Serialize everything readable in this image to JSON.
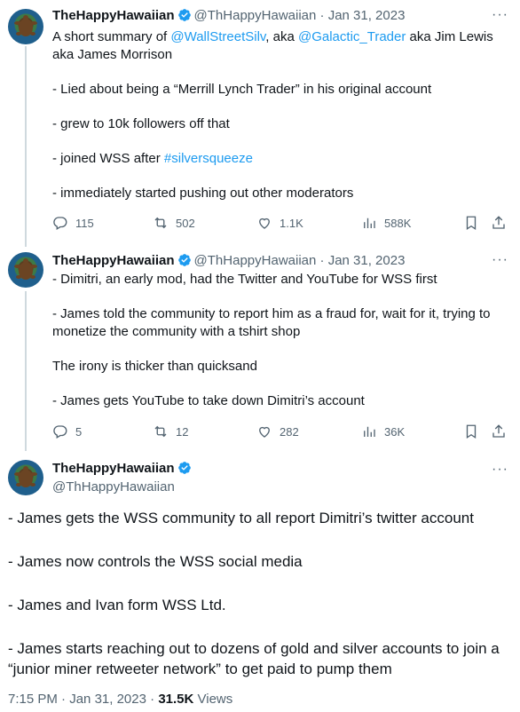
{
  "tweets": [
    {
      "name": "TheHappyHawaiian",
      "handle": "@ThHappyHawaiian",
      "sep": "·",
      "date": "Jan 31, 2023",
      "intro_prefix": "A short summary of ",
      "mention1": "@WallStreetSilv",
      "intro_mid": ", aka ",
      "mention2": "@Galactic_Trader",
      "intro_suffix": " aka Jim Lewis aka James Morrison",
      "line2": "- Lied about being a “Merrill Lynch Trader” in his original account",
      "line3": "- grew to 10k followers off that",
      "line4_prefix": "- joined WSS after ",
      "hashtag": "#silversqueeze",
      "line5": "- immediately started pushing out other moderators",
      "replies": "115",
      "retweets": "502",
      "likes": "1.1K",
      "views": "588K"
    },
    {
      "name": "TheHappyHawaiian",
      "handle": "@ThHappyHawaiian",
      "sep": "·",
      "date": "Jan 31, 2023",
      "paragraphs": [
        "- Dimitri, an early mod, had the Twitter and YouTube for WSS first",
        "- James told the community to report him as a fraud for, wait for it, trying to monetize the community with a tshirt shop",
        "The irony is thicker than quicksand",
        "- James gets YouTube to take down Dimitri’s account"
      ],
      "replies": "5",
      "retweets": "12",
      "likes": "282",
      "views": "36K"
    }
  ],
  "main_tweet": {
    "name": "TheHappyHawaiian",
    "handle": "@ThHappyHawaiian",
    "paragraphs": [
      "- James gets the WSS community to all report Dimitri’s twitter account",
      "- James now controls the WSS social media",
      "- James and Ivan form WSS Ltd.",
      "- James starts reaching out to dozens of gold and silver accounts to join a “junior miner retweeter network” to get paid to pump them"
    ],
    "time": "7:15 PM",
    "sep": "·",
    "date": "Jan 31, 2023",
    "sep2": "·",
    "views_count": "31.5K",
    "views_label": "Views"
  },
  "icons": {
    "verified": "verified-badge-icon",
    "more": "more-icon",
    "reply": "reply-icon",
    "retweet": "retweet-icon",
    "like": "like-icon",
    "views": "views-icon",
    "bookmark": "bookmark-icon",
    "share": "share-icon"
  },
  "colors": {
    "link": "#1d9bf0",
    "secondary": "#536471",
    "text": "#0f1419",
    "thread_line": "#cfd9de"
  }
}
